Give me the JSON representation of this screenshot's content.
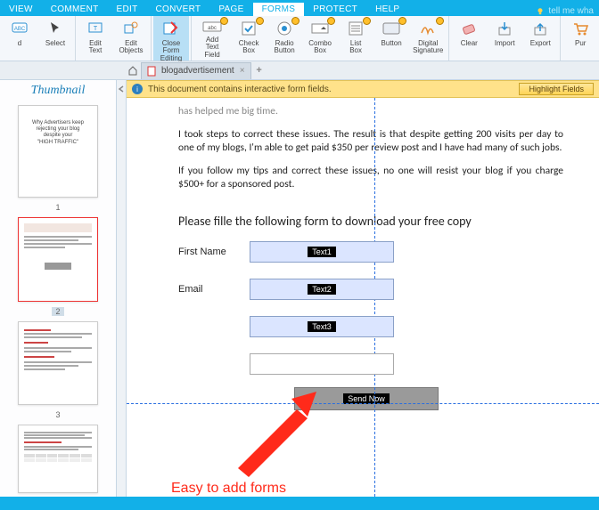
{
  "tabs": {
    "view": "VIEW",
    "comment": "COMMENT",
    "edit": "EDIT",
    "convert": "CONVERT",
    "page": "PAGE",
    "forms": "FORMS",
    "protect": "PROTECT",
    "help": "HELP"
  },
  "tellme": "tell me wha",
  "ribbon": {
    "d": "d",
    "select": "Select",
    "edit_text": "Edit Text",
    "edit_objects": "Edit Objects",
    "close_form": "Close Form Editing",
    "add_text_field": "Add\nText Field",
    "check_box": "Check\nBox",
    "radio_button": "Radio\nButton",
    "combo_box": "Combo\nBox",
    "list_box": "List\nBox",
    "button": "Button",
    "digital_signature": "Digital\nSignature",
    "clear": "Clear",
    "import": "Import",
    "export": "Export",
    "purge": "Pur"
  },
  "thumb_header": "Thumbnail",
  "thumb": {
    "p1_title": "Why Advertisers keep\nrejecting your blog\ndespite your\n\"HIGH TRAFFIC\"",
    "n1": "1",
    "n2": "2",
    "n3": "3"
  },
  "doc_tab": "blogadvertisement",
  "infobar_msg": "This document contains interactive form fields.",
  "highlight_btn": "Highlight Fields",
  "content": {
    "trunc": "has helped me big time.",
    "p1": "I took steps to correct these issues. The result is that despite getting 200 visits per day to one of my blogs, I'm able to get paid $350 per review post and I have had many of such jobs.",
    "p2": "If you follow my tips and correct these issues, no one will resist your blog if you charge $500+ for a sponsored post.",
    "form_title": "Please fille the following form to download your free copy",
    "first_name": "First Name",
    "email": "Email",
    "t1": "Text1",
    "t2": "Text2",
    "t3": "Text3",
    "send": "Send Now"
  },
  "annotation": "Easy to add forms"
}
